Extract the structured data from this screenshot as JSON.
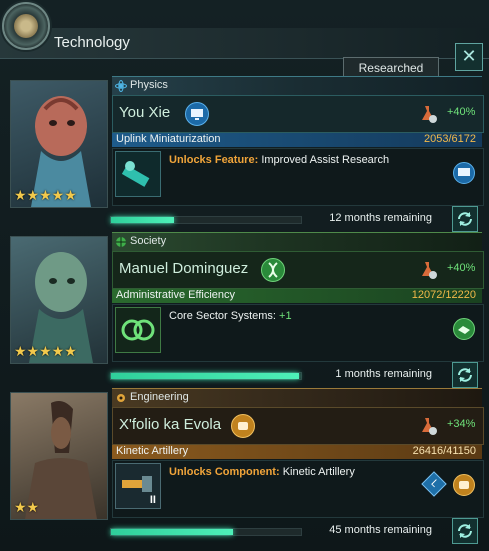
{
  "window": {
    "title": "Technology",
    "close_label": "✕",
    "researched_label": "Researched"
  },
  "colors": {
    "physics": "#2f8fd0",
    "society": "#38a84a",
    "engineering": "#d08a2a",
    "progress": "#3ee2b0"
  },
  "sections": [
    {
      "category": "Physics",
      "category_icon": "atom-icon",
      "scientist": "You Xie",
      "scientist_trait_icon": "computer-icon",
      "bonus": "+40%",
      "stars": "★★★★★",
      "project": "Uplink Miniaturization",
      "progress_text": "2053/6172",
      "progress_fraction": 0.333,
      "progress_color": "#f2b94a",
      "unlock_key": "Unlocks Feature:",
      "unlock_key_color": "#f0a43a",
      "unlock_value": "Improved Assist Research",
      "remaining": "12 months remaining"
    },
    {
      "category": "Society",
      "category_icon": "globe-icon",
      "scientist": "Manuel Dominguez",
      "scientist_trait_icon": "dna-icon",
      "bonus": "+40%",
      "stars": "★★★★★",
      "project": "Administrative Efficiency",
      "progress_text": "12072/12220",
      "progress_fraction": 0.988,
      "progress_color": "#f2b94a",
      "unlock_key": "Core Sector Systems:",
      "unlock_key_color": "#eef3f2",
      "unlock_value": "+1",
      "remaining": "1 months remaining"
    },
    {
      "category": "Engineering",
      "category_icon": "gear-icon",
      "scientist": "X'folio ka Evola",
      "scientist_trait_icon": "engineering-fist-icon",
      "bonus": "+34%",
      "stars": "★★",
      "project": "Kinetic Artillery",
      "progress_text": "26416/41150",
      "progress_fraction": 0.642,
      "progress_color": "#f2b94a",
      "unlock_key": "Unlocks Component:",
      "unlock_key_color": "#f0a43a",
      "unlock_value": "Kinetic Artillery",
      "size_badge": "L",
      "tier_label": "II",
      "remaining": "45 months remaining"
    }
  ]
}
